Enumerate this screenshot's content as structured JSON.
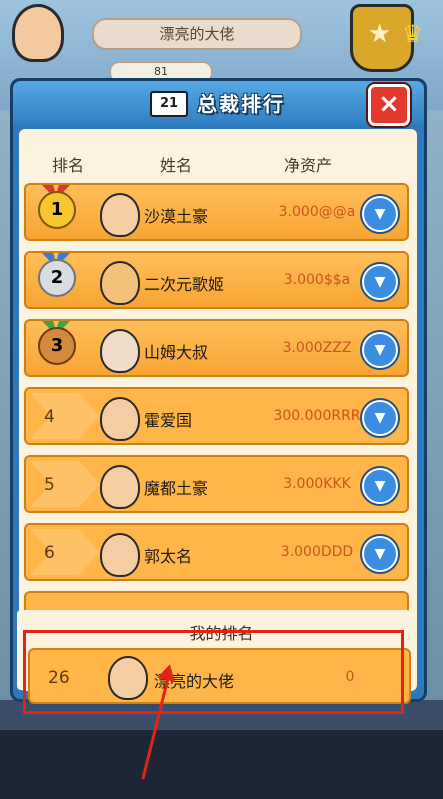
{
  "background": {
    "player_name": "漂亮的大佬",
    "stat_value": "81"
  },
  "modal": {
    "title_icon_text": "21",
    "title": "总裁排行",
    "close_label": "×",
    "headers": {
      "rank": "排名",
      "name": "姓名",
      "net_worth": "净资产"
    }
  },
  "leaderboard": [
    {
      "rank": "1",
      "name": "沙漠土豪",
      "net_worth": "3.000@@a",
      "medal": "gold"
    },
    {
      "rank": "2",
      "name": "二次元歌姬",
      "net_worth": "3.000$$a",
      "medal": "silver"
    },
    {
      "rank": "3",
      "name": "山姆大叔",
      "net_worth": "3.000ZZZ",
      "medal": "bronze"
    },
    {
      "rank": "4",
      "name": "霍爱国",
      "net_worth": "300.000RRR"
    },
    {
      "rank": "5",
      "name": "魔都土豪",
      "net_worth": "3.000KKK"
    },
    {
      "rank": "6",
      "name": "郭太名",
      "net_worth": "3.000DDD"
    }
  ],
  "my_ranking": {
    "label": "我的排名",
    "rank": "26",
    "name": "漂亮的大佬",
    "net_worth": "0"
  },
  "colors": {
    "row_fill": "#ffb547",
    "worth_text": "#c9561a",
    "expand_button": "#3b8de0",
    "highlight": "#e2231a"
  },
  "icons": {
    "expand": "chevron-down-icon",
    "close": "close-icon",
    "title": "podium-icon"
  }
}
